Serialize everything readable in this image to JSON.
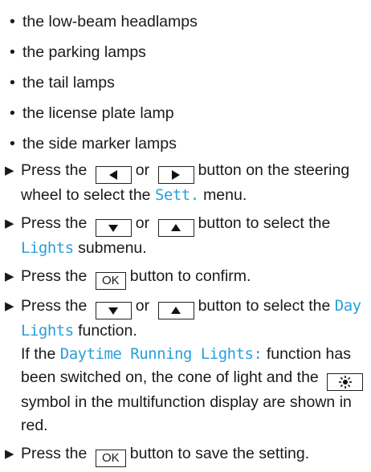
{
  "bullets": [
    "the low-beam headlamps",
    "the parking lamps",
    "the tail lamps",
    "the license plate lamp",
    "the side marker lamps"
  ],
  "steps": [
    {
      "t1": "Press the",
      "t2": "or",
      "t3": "button on the steering wheel to select the",
      "menu": "Sett.",
      "t4": "menu."
    },
    {
      "t1": "Press the",
      "t2": "or",
      "t3": "button to select the",
      "menu": "Lights",
      "t4": "submenu."
    },
    {
      "t1": "Press the",
      "key": "OK",
      "t2": "button to confirm."
    },
    {
      "t1": "Press the",
      "t2": "or",
      "t3": "button to select the",
      "menu": "Day Lights",
      "t4": "function.",
      "t5": "If the",
      "menu2": "Daytime Running Lights:",
      "t6": "function has been switched on, the cone of light and the",
      "t7": "symbol in the multifunction display are shown in red."
    },
    {
      "t1": "Press the",
      "key": "OK",
      "t2": "button to save the setting."
    }
  ],
  "icons": {
    "left": "left-arrow-key-icon",
    "right": "right-arrow-key-icon",
    "down": "down-arrow-key-icon",
    "up": "up-arrow-key-icon",
    "light": "light-symbol-icon",
    "step": "step-arrow-icon"
  },
  "colors": {
    "accent": "#2a9fd8",
    "text": "#1a1a1a"
  }
}
